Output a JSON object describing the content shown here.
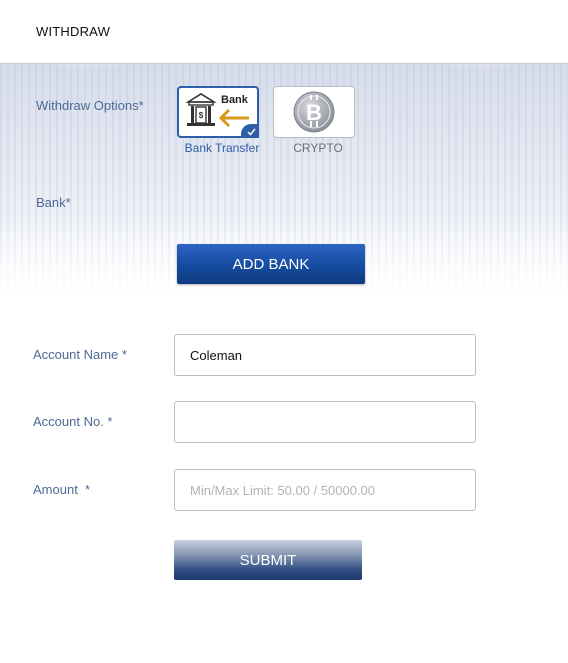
{
  "header": {
    "title": "WITHDRAW"
  },
  "withdraw_options": {
    "label": "Withdraw Options*",
    "options": [
      {
        "icon_text": "Bank",
        "caption": "Bank Transfer",
        "selected": true,
        "icon": "bank-transfer-icon"
      },
      {
        "caption": "CRYPTO",
        "selected": false,
        "icon": "bitcoin-icon"
      }
    ]
  },
  "bank": {
    "label": "Bank*",
    "add_button": "ADD BANK"
  },
  "form": {
    "account_name": {
      "label": "Account Name *",
      "value": "Coleman"
    },
    "account_no": {
      "label": "Account No. *",
      "value": ""
    },
    "amount": {
      "label": "Amount  *",
      "placeholder": "Min/Max Limit: 50.00 / 50000.00"
    },
    "submit_label": "SUBMIT"
  },
  "colors": {
    "accent": "#2f5ea8",
    "label": "#4e6a96",
    "button_blue": "#154b9f",
    "coin": "#9a9ea6"
  }
}
